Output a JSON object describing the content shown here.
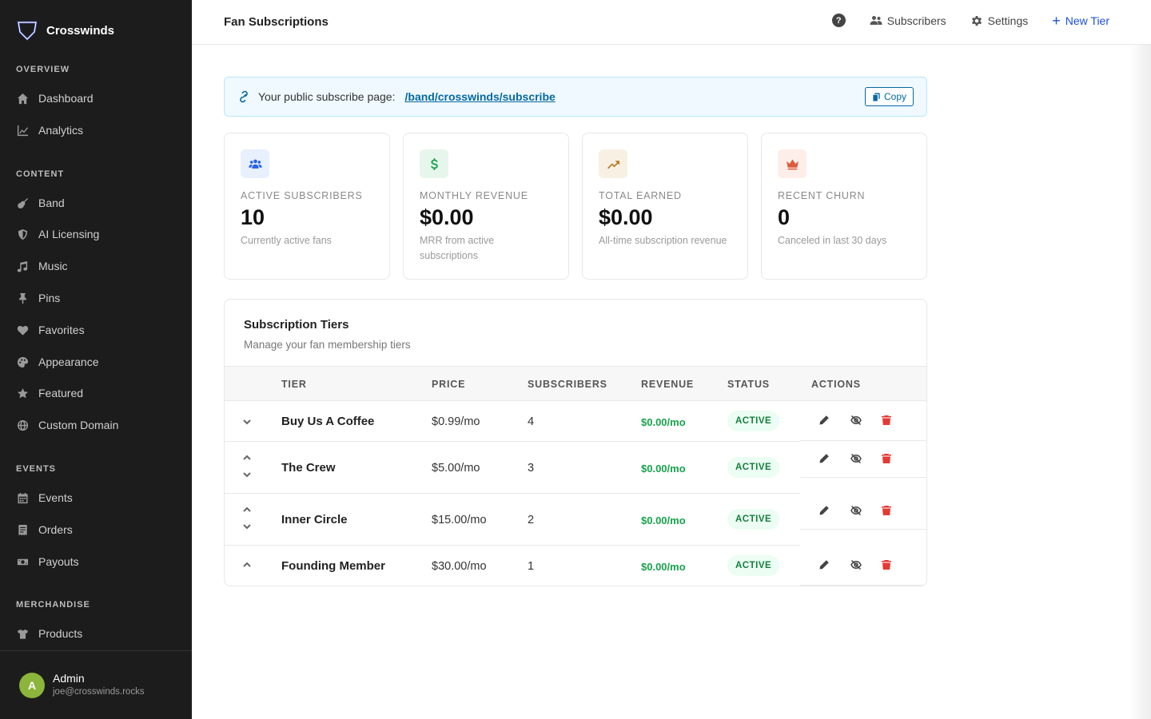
{
  "brand": {
    "name": "Crosswinds"
  },
  "sidebar": {
    "sections": [
      {
        "title": "OVERVIEW"
      },
      {
        "title": "CONTENT"
      },
      {
        "title": "EVENTS"
      },
      {
        "title": "MERCHANDISE"
      }
    ],
    "items": [
      {
        "label": "Dashboard",
        "icon": "home-icon"
      },
      {
        "label": "Analytics",
        "icon": "chart-line-icon"
      },
      {
        "label": "Band",
        "icon": "guitar-icon"
      },
      {
        "label": "AI Licensing",
        "icon": "shield-icon"
      },
      {
        "label": "Music",
        "icon": "music-note-icon"
      },
      {
        "label": "Pins",
        "icon": "pin-icon"
      },
      {
        "label": "Favorites",
        "icon": "heart-icon"
      },
      {
        "label": "Appearance",
        "icon": "palette-icon"
      },
      {
        "label": "Featured",
        "icon": "star-icon"
      },
      {
        "label": "Custom Domain",
        "icon": "globe-icon"
      },
      {
        "label": "Events",
        "icon": "calendar-icon"
      },
      {
        "label": "Orders",
        "icon": "receipt-icon"
      },
      {
        "label": "Payouts",
        "icon": "money-icon"
      },
      {
        "label": "Products",
        "icon": "tshirt-icon"
      }
    ]
  },
  "user": {
    "initial": "A",
    "name": "Admin",
    "email": "joe@crosswinds.rocks"
  },
  "topbar": {
    "title": "Fan Subscriptions",
    "help": "?",
    "subscribers_label": "Subscribers",
    "settings_label": "Settings",
    "new_tier_label": "New Tier"
  },
  "banner": {
    "label": "Your public subscribe page:",
    "link": "/band/crosswinds/subscribe",
    "copy_label": "Copy"
  },
  "stats": [
    {
      "label": "ACTIVE SUBSCRIBERS",
      "value": "10",
      "sub": "Currently active fans",
      "icon": "users-icon",
      "color": "#2563eb",
      "bg": "#e8f0fe"
    },
    {
      "label": "MONTHLY REVENUE",
      "value": "$0.00",
      "sub": "MRR from active subscriptions",
      "icon": "dollar-icon",
      "color": "#16a34a",
      "bg": "#e7f6ec"
    },
    {
      "label": "TOTAL EARNED",
      "value": "$0.00",
      "sub": "All-time subscription revenue",
      "icon": "trend-up-icon",
      "color": "#b7791f",
      "bg": "#f8f1e3"
    },
    {
      "label": "RECENT CHURN",
      "value": "0",
      "sub": "Canceled in last 30 days",
      "icon": "crown-icon",
      "color": "#dc5a3c",
      "bg": "#fdeee9"
    }
  ],
  "tiers": {
    "title": "Subscription Tiers",
    "subtitle": "Manage your fan membership tiers",
    "columns": [
      "TIER",
      "PRICE",
      "SUBSCRIBERS",
      "REVENUE",
      "STATUS",
      "ACTIONS"
    ],
    "rows": [
      {
        "name": "Buy Us A Coffee",
        "price": "$0.99/mo",
        "subscribers": "4",
        "revenue": "$0.00/mo",
        "status": "ACTIVE"
      },
      {
        "name": "The Crew",
        "price": "$5.00/mo",
        "subscribers": "3",
        "revenue": "$0.00/mo",
        "status": "ACTIVE"
      },
      {
        "name": "Inner Circle",
        "price": "$15.00/mo",
        "subscribers": "2",
        "revenue": "$0.00/mo",
        "status": "ACTIVE"
      },
      {
        "name": "Founding Member",
        "price": "$30.00/mo",
        "subscribers": "1",
        "revenue": "$0.00/mo",
        "status": "ACTIVE"
      }
    ]
  },
  "colors": {
    "sidebar_bg": "#1c1c1c",
    "accent": "#1d4ed8",
    "link": "#0369a1",
    "success": "#16a34a",
    "danger": "#e53935"
  }
}
